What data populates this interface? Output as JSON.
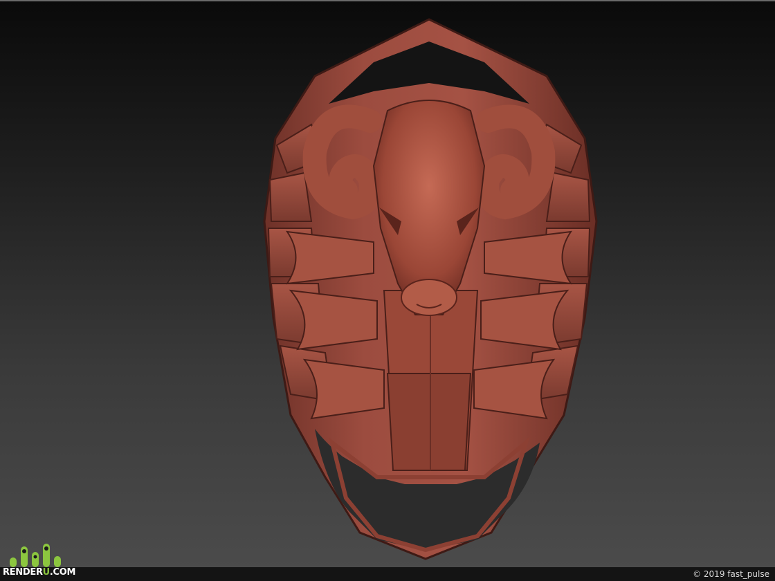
{
  "logo": {
    "text_main_1": "RENDER",
    "text_accent": "U",
    "text_main_2": ".COM",
    "brand_color": "#8cc63f"
  },
  "footer": {
    "copyright": "© 2019 fast_pulse"
  },
  "colors": {
    "clay": "#9a4a3e",
    "clay_dark": "#5e2a22",
    "clay_light": "#c0685a"
  }
}
